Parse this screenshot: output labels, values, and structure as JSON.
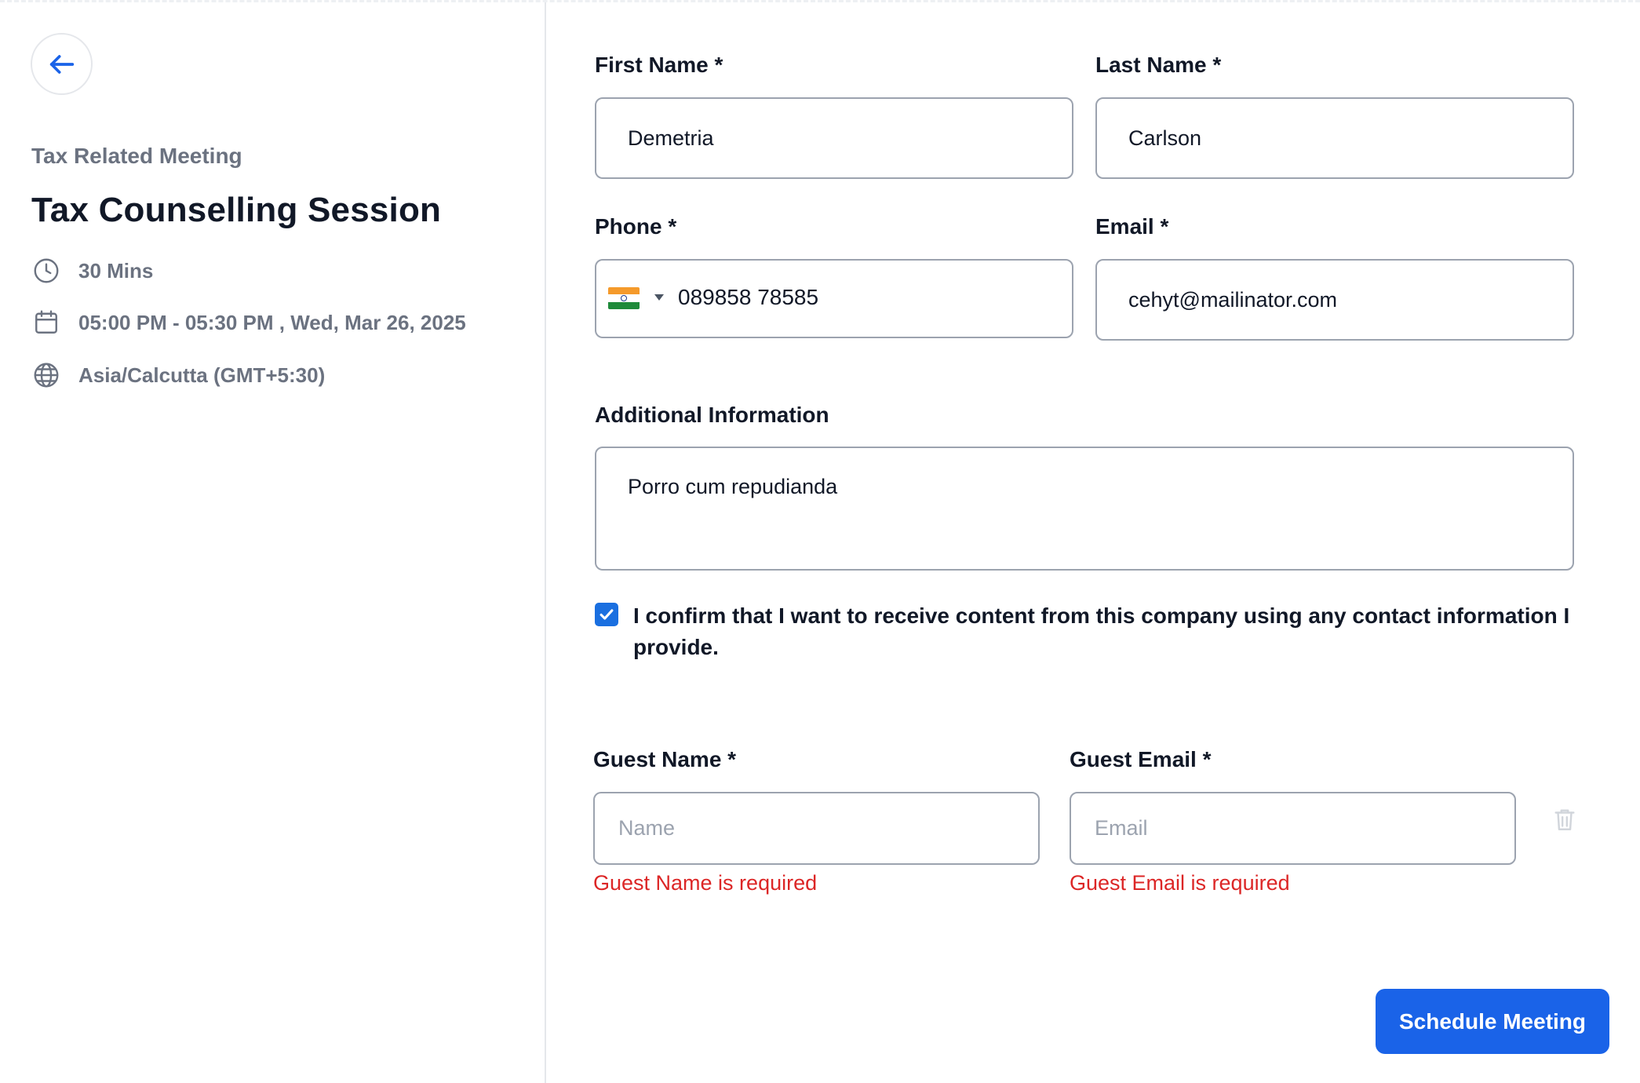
{
  "event": {
    "category": "Tax Related Meeting",
    "title": "Tax Counselling Session",
    "duration": "30 Mins",
    "datetime": "05:00 PM - 05:30 PM , Wed, Mar 26, 2025",
    "timezone": "Asia/Calcutta (GMT+5:30)"
  },
  "form": {
    "first_name": {
      "label": "First Name *",
      "value": "Demetria"
    },
    "last_name": {
      "label": "Last Name *",
      "value": "Carlson"
    },
    "phone": {
      "label": "Phone *",
      "country_flag": "india-flag-icon",
      "value": "089858 78585"
    },
    "email": {
      "label": "Email *",
      "value": "cehyt@mailinator.com"
    },
    "additional_info": {
      "label": "Additional Information",
      "value": "Porro cum repudianda"
    },
    "consent": {
      "checked": true,
      "text": "I confirm that I want to receive content from this company using any contact information I provide."
    },
    "guest_name": {
      "label": "Guest Name *",
      "placeholder": "Name",
      "error": "Guest Name is required"
    },
    "guest_email": {
      "label": "Guest Email *",
      "placeholder": "Email",
      "error": "Guest Email is required"
    },
    "submit_label": "Schedule Meeting"
  },
  "icons": {
    "back": "arrow-left-icon",
    "duration": "clock-icon",
    "datetime": "calendar-icon",
    "timezone": "globe-icon",
    "delete_guest": "trash-icon",
    "consent": "checkmark-icon"
  },
  "colors": {
    "primary": "#1a63e8",
    "error": "#dc2626",
    "muted_text": "#6b7280",
    "border": "#9ca3af"
  }
}
